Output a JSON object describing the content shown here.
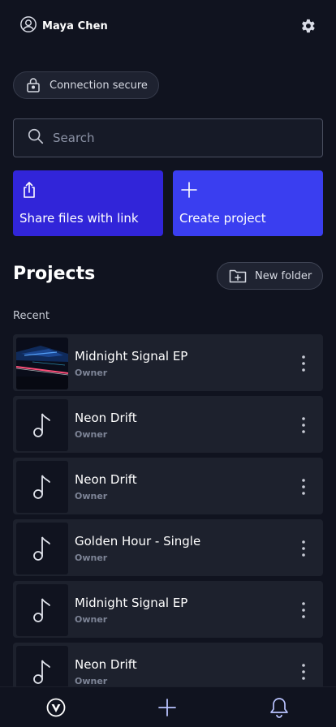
{
  "header": {
    "user_name": "Maya Chen",
    "user_icon": "user-circle-icon",
    "settings_icon": "gear-icon"
  },
  "badge": {
    "label": "Connection secure",
    "icon": "lock-icon"
  },
  "search": {
    "placeholder": "Search",
    "icon": "search-icon"
  },
  "actions": {
    "share_label": "Share files with link",
    "share_icon": "share-upload-icon",
    "create_label": "Create project",
    "create_icon": "plus-icon"
  },
  "projects": {
    "title": "Projects",
    "new_folder_label": "New folder",
    "recent_label": "Recent",
    "items": [
      {
        "title": "Midnight Signal EP",
        "role": "Owner",
        "thumbnail": "image"
      },
      {
        "title": "Neon Drift",
        "role": "Owner",
        "thumbnail": "music-note-icon"
      },
      {
        "title": "Neon Drift",
        "role": "Owner",
        "thumbnail": "music-note-icon"
      },
      {
        "title": "Golden Hour - Single",
        "role": "Owner",
        "thumbnail": "music-note-icon"
      },
      {
        "title": "Midnight Signal EP",
        "role": "Owner",
        "thumbnail": "music-note-icon"
      },
      {
        "title": "Neon Drift",
        "role": "Owner",
        "thumbnail": "music-note-icon"
      }
    ]
  },
  "bottom_nav": {
    "items": [
      "logo-icon",
      "plus-icon",
      "bell-icon"
    ]
  },
  "colors": {
    "background": "#10131f",
    "share_button": "#3125d9",
    "create_button": "#3a3ef0",
    "card": "#1d212d"
  }
}
